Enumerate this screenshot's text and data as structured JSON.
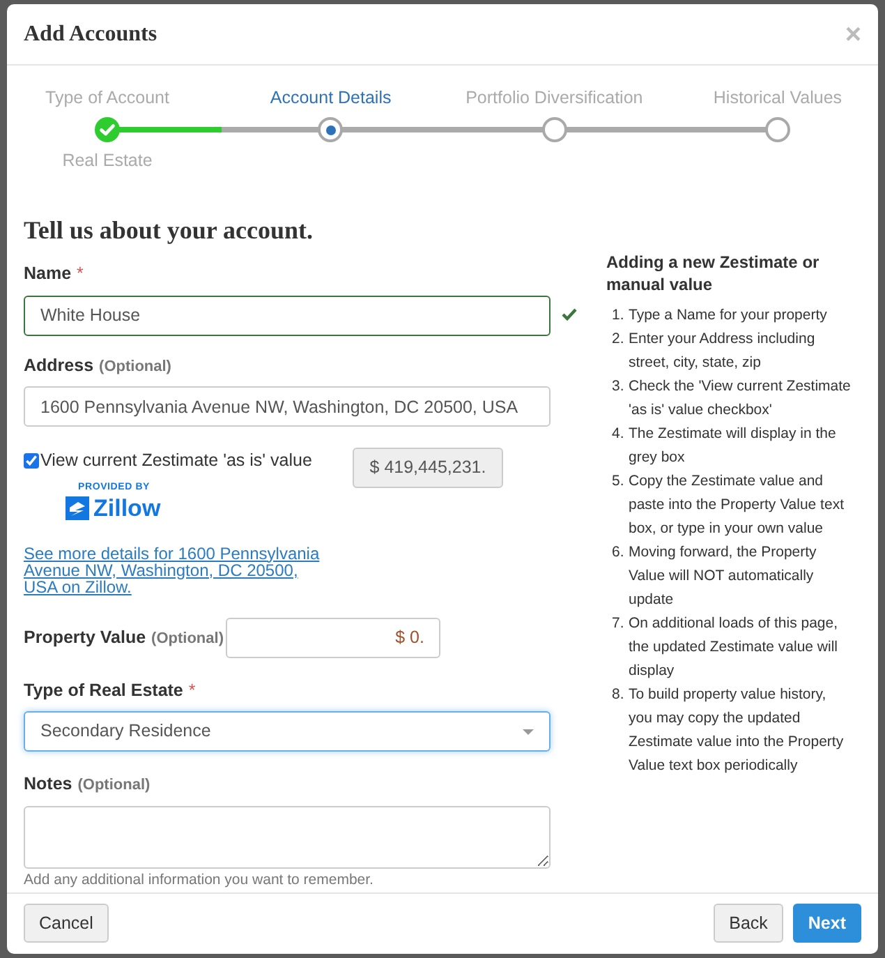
{
  "dialog": {
    "title": "Add Accounts",
    "close": "×"
  },
  "steps": [
    {
      "label": "Type of Account",
      "kind": "done",
      "sublabel": "Real Estate"
    },
    {
      "label": "Account Details",
      "kind": "current"
    },
    {
      "label": "Portfolio Diversification",
      "kind": "upcoming"
    },
    {
      "label": "Historical Values",
      "kind": "upcoming"
    }
  ],
  "heading": "Tell us about your account.",
  "name_field": {
    "label": "Name",
    "required": "*",
    "value": "White House",
    "valid": true
  },
  "address_field": {
    "label": "Address",
    "hint": "(Optional)",
    "value": "1600 Pennsylvania Avenue NW, Washington, DC 20500, USA"
  },
  "zestimate": {
    "label": "View current Zestimate 'as is' value",
    "checked": true,
    "value": "$ 419,445,231.",
    "provided_by": "PROVIDED BY",
    "brand": "Zillow"
  },
  "details_link": "See more details for 1600 Pennsylvania Avenue NW, Washington, DC 20500, USA on Zillow.",
  "property_value": {
    "label": "Property Value",
    "hint": "(Optional)",
    "value": "$ 0."
  },
  "real_estate_type": {
    "label": "Type of Real Estate",
    "required": "*",
    "value": "Secondary Residence"
  },
  "notes": {
    "label": "Notes",
    "hint": "(Optional)",
    "help": "Add any additional information you want to remember."
  },
  "help": {
    "title": "Adding a new Zestimate or manual value",
    "steps": [
      {
        "number": "1.",
        "text": "Type a Name for your property"
      },
      {
        "number": "2.",
        "text": "Enter your Address including street, city, state, zip"
      },
      {
        "number": "3.",
        "text": "Check the 'View current Zestimate 'as is' value checkbox'"
      },
      {
        "number": "4.",
        "text": "The Zestimate will display in the grey box"
      },
      {
        "number": "5.",
        "text": "Copy the Zestimate value and paste into the Property Value text box, or type in your own value"
      },
      {
        "number": "6.",
        "text": "Moving forward, the Property Value will NOT automatically update"
      },
      {
        "number": "7.",
        "text": "On additional loads of this page, the updated Zestimate value will display"
      },
      {
        "number": "8.",
        "text": "To build property value history, you may copy the updated Zestimate value into the Property Value text box periodically"
      }
    ]
  },
  "buttons": {
    "cancel": "Cancel",
    "back": "Back",
    "next": "Next"
  }
}
